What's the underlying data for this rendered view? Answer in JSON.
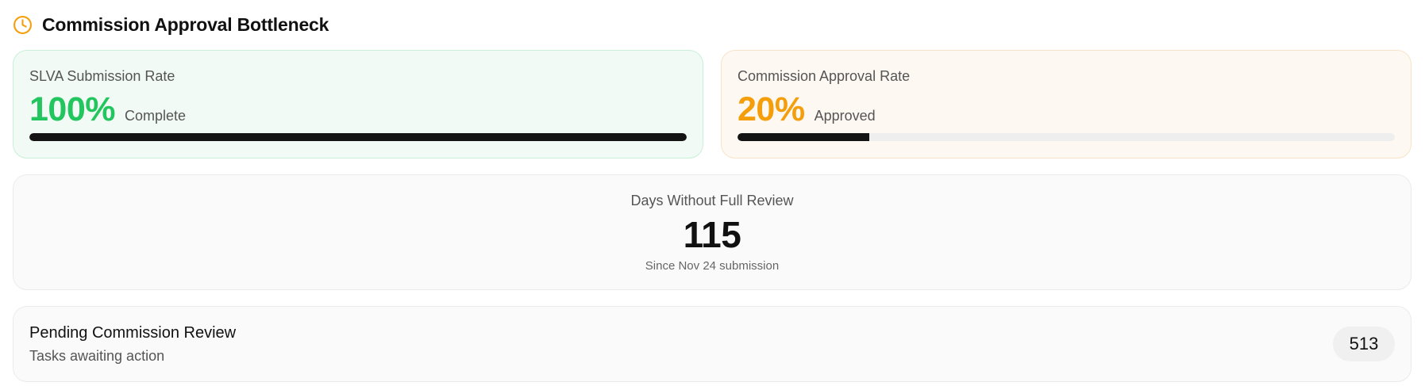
{
  "header": {
    "title": "Commission Approval Bottleneck",
    "icon": "clock-icon",
    "icon_color": "#f59e0b"
  },
  "submission": {
    "label": "SLVA Submission Rate",
    "value": "100%",
    "suffix": "Complete",
    "progress": 1.0,
    "accent": "#22c55e"
  },
  "approval": {
    "label": "Commission Approval Rate",
    "value": "20%",
    "suffix": "Approved",
    "progress": 0.2,
    "accent": "#f59e0b"
  },
  "days_without_review": {
    "label": "Days Without Full Review",
    "value": "115",
    "subtext": "Since Nov 24 submission"
  },
  "pending_review": {
    "title": "Pending Commission Review",
    "subtitle": "Tasks awaiting action",
    "count": "513"
  }
}
